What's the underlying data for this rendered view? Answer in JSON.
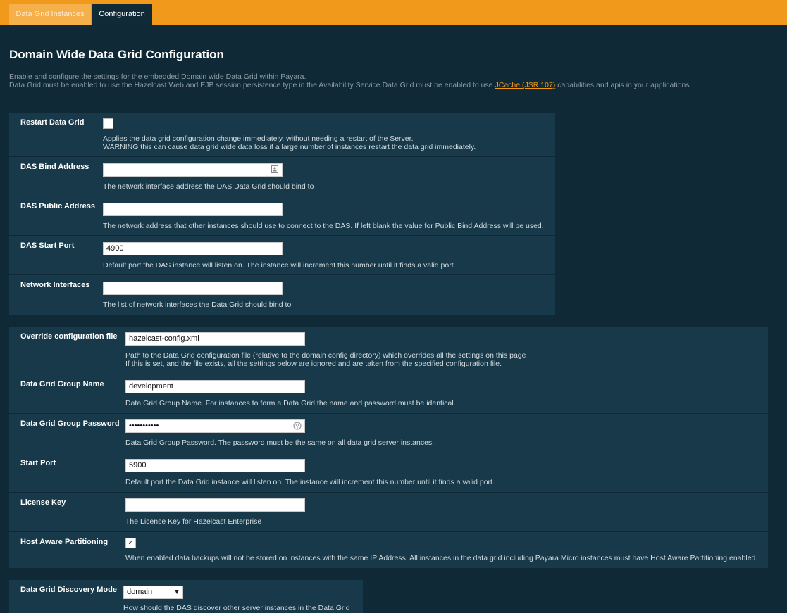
{
  "tabs": [
    {
      "label": "Data Grid Instances"
    },
    {
      "label": "Configuration"
    }
  ],
  "page": {
    "title": "Domain Wide Data Grid Configuration",
    "intro_line1": "Enable and configure the settings for the embedded Domain wide Data Grid within Payara.",
    "intro_line2_before": "Data Grid must be enabled to use the Hazelcast Web and EJB session persistence type in the Availability Service.Data Grid must be enabled to use ",
    "intro_link": "JCache (JSR 107)",
    "intro_line2_after": " capabilities and apis in your applications."
  },
  "das_section": {
    "restart": {
      "label": "Restart Data Grid",
      "checked": false,
      "help1": "Applies the data grid configuration change immediately, without needing a restart of the Server.",
      "help2": "WARNING this can cause data grid wide data loss if a large number of instances restart the data grid immediately."
    },
    "bind_address": {
      "label": "DAS Bind Address",
      "value": "",
      "help": "The network interface address the DAS Data Grid should bind to"
    },
    "public_address": {
      "label": "DAS Public Address",
      "value": "",
      "help": "The network address that other instances should use to connect to the DAS. If left blank the value for Public Bind Address will be used."
    },
    "start_port": {
      "label": "DAS Start Port",
      "value": "4900",
      "help": "Default port the DAS instance will listen on. The instance will increment this number until it finds a valid port."
    },
    "network_interfaces": {
      "label": "Network Interfaces",
      "value": "",
      "help": "The list of network interfaces the Data Grid should bind to"
    }
  },
  "grid_section": {
    "override_config": {
      "label": "Override configuration file",
      "value": "hazelcast-config.xml",
      "help1": "Path to the Data Grid configuration file (relative to the domain config directory) which overrides all the settings on this page",
      "help2": "If this is set, and the file exists, all the settings below are ignored and are taken from the specified configuration file."
    },
    "group_name": {
      "label": "Data Grid Group Name",
      "value": "development",
      "help": "Data Grid Group Name. For instances to form a Data Grid the name and password must be identical."
    },
    "group_password": {
      "label": "Data Grid Group Password",
      "value": "•••••••••••",
      "help": "Data Grid Group Password. The password must be the same on all data grid server instances."
    },
    "start_port": {
      "label": "Start Port",
      "value": "5900",
      "help": "Default port the Data Grid instance will listen on. The instance will increment this number until it finds a valid port."
    },
    "license_key": {
      "label": "License Key",
      "value": "",
      "help": "The License Key for Hazelcast Enterprise"
    },
    "host_aware": {
      "label": "Host Aware Partitioning",
      "checked": true,
      "check_glyph": "✓",
      "help": "When enabled data backups will not be stored on instances with the same IP Address. All instances in the data grid including Payara Micro instances must have Host Aware Partitioning enabled."
    }
  },
  "discovery_section": {
    "mode": {
      "label": "Data Grid Discovery Mode",
      "value": "domain",
      "caret": "▼",
      "help": "How should the DAS discover other server instances in the Data Grid"
    }
  },
  "colors": {
    "topbar": "#f0991b",
    "background": "#0f2936",
    "panel": "#17394a",
    "link": "#f0991b"
  },
  "icons": {
    "contact_card": "contact-card-icon",
    "password_reveal": "password-reveal-icon"
  }
}
